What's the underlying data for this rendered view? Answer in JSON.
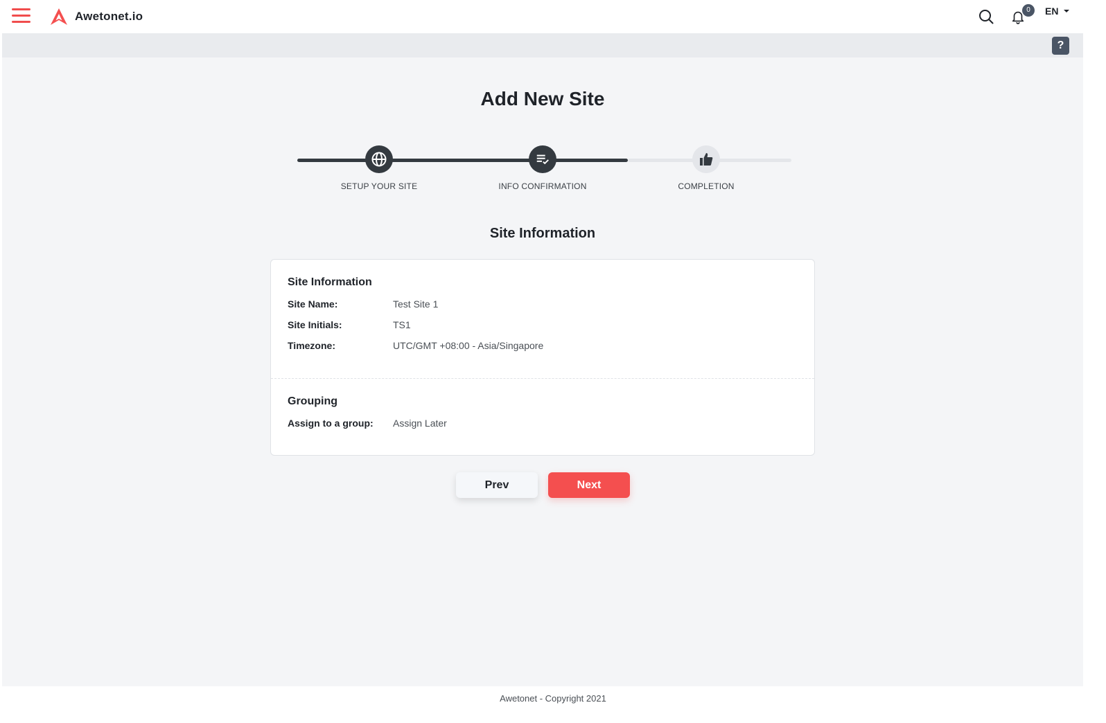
{
  "app": {
    "brand": "Awetonet.io",
    "accent_color": "#f44f4f"
  },
  "topbar": {
    "menu_icon": "hamburger-icon",
    "search_icon": "search-icon",
    "notification_icon": "bell-icon",
    "notification_count": "0",
    "language": "EN",
    "help_label": "?"
  },
  "page": {
    "title": "Add New Site",
    "section_title": "Site Information"
  },
  "stepper": {
    "steps": [
      {
        "label": "SETUP YOUR SITE",
        "icon": "globe-icon",
        "state": "done"
      },
      {
        "label": "INFO CONFIRMATION",
        "icon": "checklist-icon",
        "state": "active"
      },
      {
        "label": "COMPLETION",
        "icon": "thumbs-up-icon",
        "state": "pending"
      }
    ]
  },
  "card": {
    "site_info": {
      "heading": "Site Information",
      "rows": [
        {
          "label": "Site Name:",
          "value": "Test Site 1"
        },
        {
          "label": "Site Initials:",
          "value": "TS1"
        },
        {
          "label": "Timezone:",
          "value": "UTC/GMT +08:00 - Asia/Singapore"
        }
      ]
    },
    "grouping": {
      "heading": "Grouping",
      "rows": [
        {
          "label": "Assign to a group:",
          "value": "Assign Later"
        }
      ]
    }
  },
  "actions": {
    "prev_label": "Prev",
    "next_label": "Next"
  },
  "footer": {
    "text": "Awetonet - Copyright 2021"
  }
}
